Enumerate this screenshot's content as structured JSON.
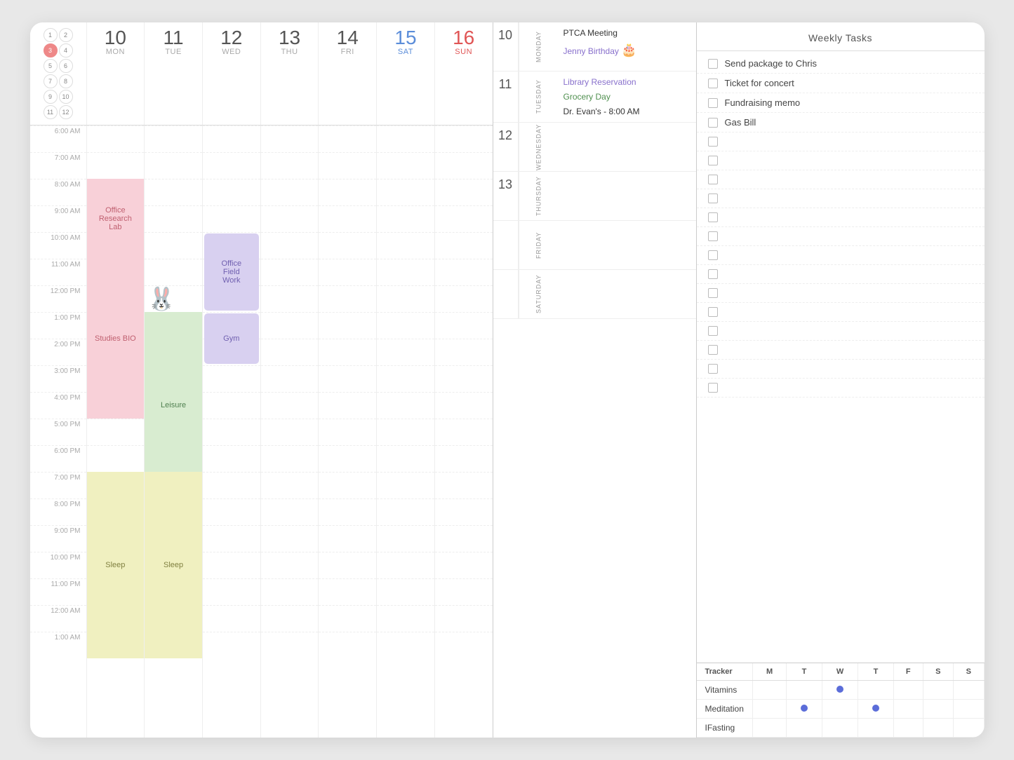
{
  "calendar": {
    "week_numbers": [
      {
        "n": "1",
        "active": false
      },
      {
        "n": "2",
        "active": false
      },
      {
        "n": "3",
        "active": true
      },
      {
        "n": "4",
        "active": false
      },
      {
        "n": "5",
        "active": false
      },
      {
        "n": "6",
        "active": false
      },
      {
        "n": "7",
        "active": false
      },
      {
        "n": "8",
        "active": false
      },
      {
        "n": "9",
        "active": false
      },
      {
        "n": "10",
        "active": false
      },
      {
        "n": "11",
        "active": false
      },
      {
        "n": "12",
        "active": false
      }
    ],
    "days": [
      {
        "number": "10",
        "name": "MON",
        "class": ""
      },
      {
        "number": "11",
        "name": "TUE",
        "class": ""
      },
      {
        "number": "12",
        "name": "WED",
        "class": ""
      },
      {
        "number": "13",
        "name": "THU",
        "class": ""
      },
      {
        "number": "14",
        "name": "FRI",
        "class": ""
      },
      {
        "number": "15",
        "name": "SAT",
        "class": "sat"
      },
      {
        "number": "16",
        "name": "SUN",
        "class": "sun"
      }
    ],
    "times": [
      "6:00 AM",
      "7:00 AM",
      "8:00 AM",
      "9:00 AM",
      "10:00 AM",
      "11:00 AM",
      "12:00 PM",
      "1:00 PM",
      "2:00 PM",
      "3:00 PM",
      "4:00 PM",
      "5:00 PM",
      "6:00 PM",
      "7:00 PM",
      "8:00 PM",
      "9:00 PM",
      "10:00 PM",
      "11:00 PM",
      "12:00 AM",
      "1:00 AM"
    ],
    "events": [
      {
        "day": 0,
        "label": "Office\nResearch\nLab",
        "color": "pink",
        "startSlot": 2,
        "spans": 3
      },
      {
        "day": 0,
        "label": "Studies\nBIO",
        "color": "pink",
        "startSlot": 6,
        "spans": 4
      },
      {
        "day": 1,
        "label": "Sleep",
        "color": "yellow",
        "startSlot": 13,
        "spans": 6
      },
      {
        "day": 2,
        "label": "Office\nField\nWork",
        "color": "purple",
        "startSlot": 4,
        "spans": 3
      },
      {
        "day": 2,
        "label": "Gym",
        "color": "purple",
        "startSlot": 7,
        "spans": 2
      },
      {
        "day": 2,
        "label": "Sleep",
        "color": "yellow",
        "startSlot": 13,
        "spans": 6
      }
    ]
  },
  "monthly": {
    "rows": [
      {
        "num": "10",
        "label": "Monday",
        "events": [
          {
            "text": "PTCA Meeting",
            "style": "black"
          },
          {
            "text": "Jenny Birthday 🎂",
            "style": "purple",
            "birthday": true
          }
        ]
      },
      {
        "num": "11",
        "label": "Tuesday",
        "events": [
          {
            "text": "Library Reservation",
            "style": "purple"
          },
          {
            "text": "Grocery Day",
            "style": "green"
          },
          {
            "text": "Dr. Evan's - 8:00 AM",
            "style": "black"
          }
        ]
      },
      {
        "num": "12",
        "label": "Wednesday",
        "events": []
      },
      {
        "num": "13",
        "label": "Thursday",
        "events": []
      },
      {
        "num": "",
        "label": "Friday",
        "events": []
      },
      {
        "num": "",
        "label": "Saturday",
        "events": []
      }
    ]
  },
  "weekly_tasks": {
    "header": "Weekly Tasks",
    "tasks": [
      {
        "label": "Send package to Chris",
        "checked": false
      },
      {
        "label": "Ticket for concert",
        "checked": false
      },
      {
        "label": "Fundraising memo",
        "checked": false
      },
      {
        "label": "Gas Bill",
        "checked": false
      }
    ],
    "empty_slots": 14
  },
  "tracker": {
    "header": "Tracker",
    "days": [
      "M",
      "T",
      "W",
      "T",
      "F",
      "S",
      "S"
    ],
    "rows": [
      {
        "label": "Vitamins",
        "dots": [
          false,
          false,
          true,
          false,
          false,
          false,
          false
        ]
      },
      {
        "label": "Meditation",
        "dots": [
          false,
          true,
          false,
          true,
          false,
          false,
          false
        ]
      },
      {
        "label": "IFasting",
        "dots": [
          false,
          false,
          false,
          false,
          false,
          false,
          false
        ]
      }
    ]
  }
}
